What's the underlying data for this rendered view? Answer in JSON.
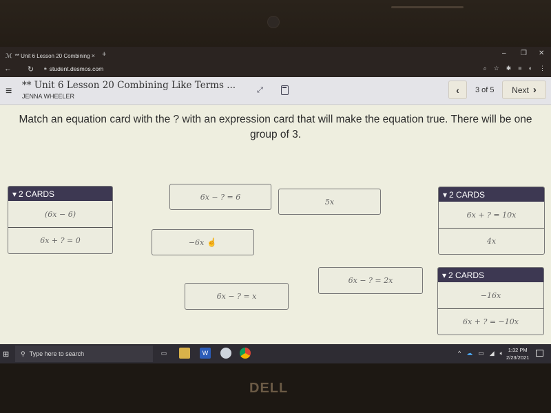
{
  "browser": {
    "tab_title": "** Unit 6 Lesson 20 Combining",
    "tab_close": "×",
    "new_tab": "+",
    "url": "student.desmos.com",
    "window_controls": {
      "minimize": "–",
      "restore": "❐",
      "close": "✕"
    }
  },
  "header": {
    "menu_icon": "≡",
    "lesson_title": "** Unit 6 Lesson 20 Combining Like Terms ...",
    "student_name": "JENNA WHEELER",
    "expand_icon": "⤢",
    "prev_label": "‹",
    "page_indicator": "3 of 5",
    "next_label": "Next",
    "next_chevron": "›"
  },
  "activity": {
    "prompt": "Match an equation card with the ? with an expression card that will make the equation true. There will be one group of 3.",
    "loose_cards": [
      {
        "text": "6x − ? = 6"
      },
      {
        "text": "5x"
      },
      {
        "text": "−6x"
      },
      {
        "text": "6x − ? = 2x"
      },
      {
        "text": "6x − ? = x"
      }
    ],
    "groups": [
      {
        "header": "2 CARDS",
        "cards": [
          "(6x − 6)",
          "6x + ? = 0"
        ]
      },
      {
        "header": "2 CARDS",
        "cards": [
          "6x + ? = 10x",
          "4x"
        ]
      },
      {
        "header": "2 CARDS",
        "cards": [
          "−16x",
          "6x + ? = −10x"
        ]
      }
    ]
  },
  "taskbar": {
    "search_placeholder": "Type here to search",
    "time": "1:32 PM",
    "date": "2/23/2021"
  },
  "device": {
    "brand": "DELL"
  }
}
